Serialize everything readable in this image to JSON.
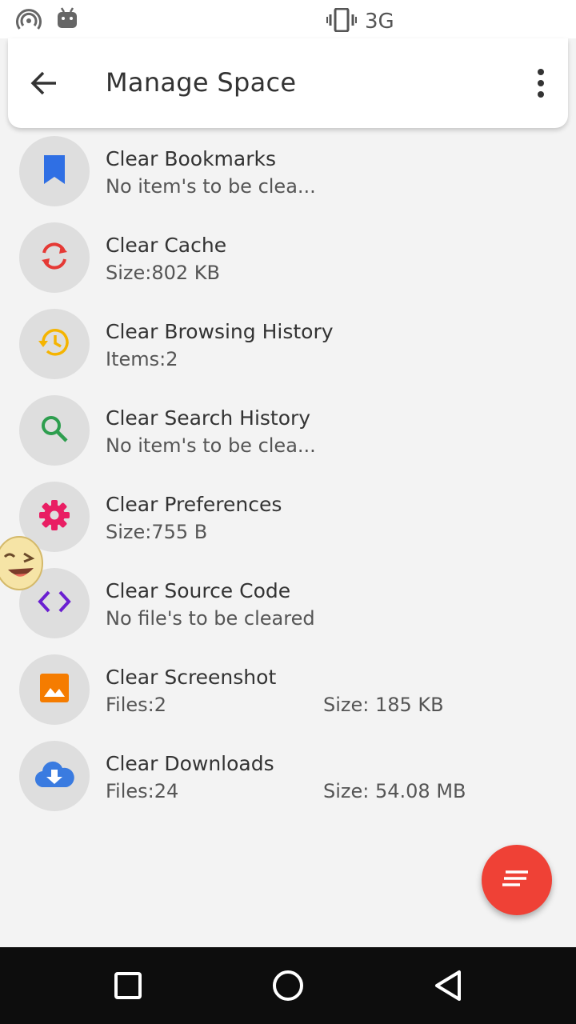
{
  "status_bar": {
    "network_label": "3G",
    "icons": [
      "hotspot-icon",
      "android-icon",
      "vibrate-icon"
    ]
  },
  "appbar": {
    "title": "Manage Space",
    "icons": [
      "back-arrow-icon",
      "more-vert-icon"
    ]
  },
  "items": [
    {
      "name": "Clear Bookmarks",
      "sub": "No item's to be clea...",
      "size": "",
      "icon": "bookmark-icon",
      "color": "#2f6fe4"
    },
    {
      "name": "Clear Cache",
      "sub": "Size:802 KB",
      "size": "",
      "icon": "sync-icon",
      "color": "#e53935"
    },
    {
      "name": "Clear Browsing History",
      "sub": "Items:2",
      "size": "",
      "icon": "history-icon",
      "color": "#f5b400"
    },
    {
      "name": "Clear Search History",
      "sub": "No item's to be clea...",
      "size": "",
      "icon": "search-icon",
      "color": "#2e9e4f"
    },
    {
      "name": "Clear Preferences",
      "sub": "Size:755 B",
      "size": "",
      "icon": "gear-icon",
      "color": "#e91e63"
    },
    {
      "name": "Clear Source Code",
      "sub": "No file's to be cleared",
      "size": "",
      "icon": "code-icon",
      "color": "#6a1fd1"
    },
    {
      "name": "Clear Screenshot",
      "sub": "Files:2",
      "size": "Size: 185 KB",
      "icon": "image-icon",
      "color": "#f57c00"
    },
    {
      "name": "Clear Downloads",
      "sub": "Files:24",
      "size": "Size: 54.08 MB",
      "icon": "cloud-download-icon",
      "color": "#3a7be0"
    }
  ],
  "fab": {
    "icon": "sort-icon",
    "color": "#ef4136"
  },
  "navbar": {
    "icons": [
      "recents-square-icon",
      "home-circle-icon",
      "back-triangle-icon"
    ]
  }
}
